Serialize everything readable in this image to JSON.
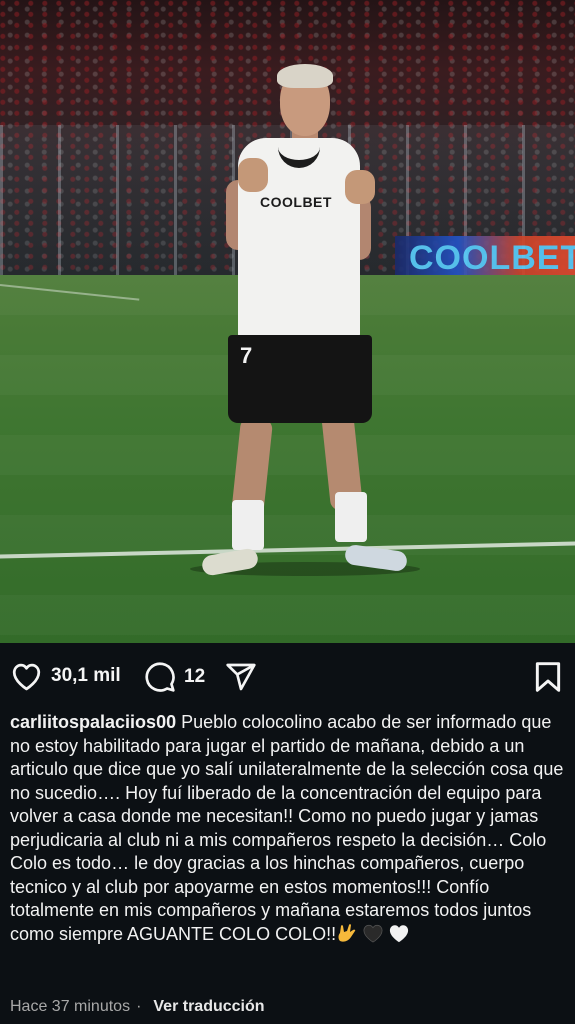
{
  "post": {
    "photo_alt": "",
    "stadium_board_text": "COOLBET",
    "shirt_sponsor": "COOLBET",
    "shirt_number": "7"
  },
  "actions": {
    "likes": "30,1 mil",
    "comments": "12"
  },
  "caption": {
    "username": "carliitospalaciios00",
    "text": "Pueblo colocolino acabo de ser informado que no estoy habilitado para jugar el partido de mañana, debido a un articulo que dice que yo salí unilateralmente de la selección cosa que no sucedio…. Hoy fuí liberado de la concentración del equipo para volver a casa donde me necesitan!! Como no puedo jugar y jamas perjudicaria al club ni a mis compañeros respeto la decisión… Colo Colo es todo… le doy gracias a los hinchas compañeros, cuerpo tecnico y al club por apoyarme en estos momentos!!! Confío totalmente en mis compañeros y mañana estaremos todos juntos como siempre AGUANTE COLO COLO!!"
  },
  "meta": {
    "time_ago": "Hace 37 minutos",
    "separator": "·",
    "translate_label": "Ver traducción"
  },
  "icons": {
    "like": "heart-outline-icon",
    "comment": "comment-bubble-icon",
    "share": "paper-plane-icon",
    "save": "bookmark-icon"
  },
  "colors": {
    "background": "#0c1014",
    "text": "#f2f2f2",
    "muted": "#a8a8a8"
  }
}
